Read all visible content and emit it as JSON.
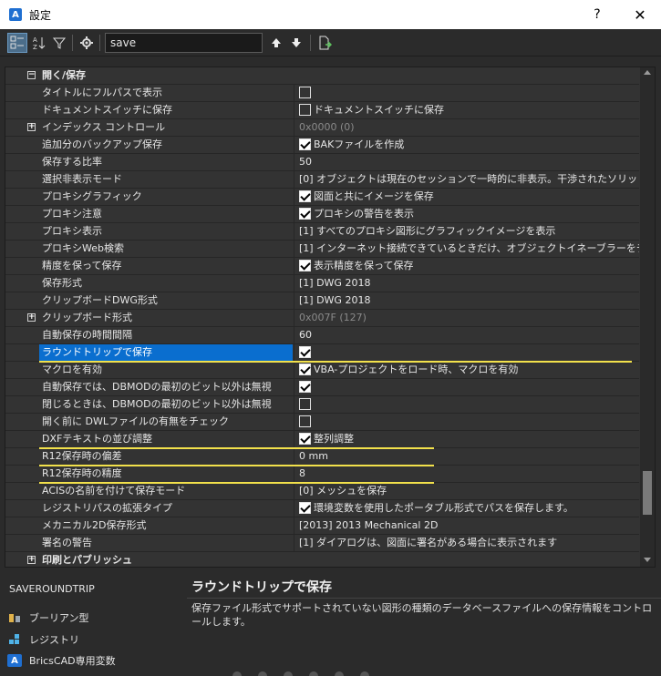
{
  "window": {
    "title": "設定",
    "help_label": "?",
    "close_label": "✕",
    "app_icon": "bricscad-icon"
  },
  "toolbar": {
    "search_value": "save",
    "buttons": [
      "categorized-view-icon",
      "alphabetical-sort-icon",
      "filter-icon",
      "settings-gear-icon",
      "arrow-up-icon",
      "arrow-down-icon",
      "export-icon"
    ]
  },
  "categories": {
    "open_save": "開く/保存",
    "print_publish": "印刷とパブリッシュ"
  },
  "rows": [
    {
      "name": "タイトルにフルパスで表示",
      "value": "",
      "checkbox": "empty"
    },
    {
      "name": "ドキュメントスイッチに保存",
      "value": "ドキュメントスイッチに保存",
      "checkbox": "empty"
    },
    {
      "name": "インデックス コントロール",
      "value": "0x0000 (0)",
      "expander": "+",
      "disabled": true
    },
    {
      "name": "追加分のバックアップ保存",
      "value": "BAKファイルを作成",
      "checkbox": "checked"
    },
    {
      "name": "保存する比率",
      "value": "50"
    },
    {
      "name": "選択非表示モード",
      "value": "[0] オブジェクトは現在のセッションで一時的に非表示。干渉されたソリッドは、干渉"
    },
    {
      "name": "プロキシグラフィック",
      "value": "図面と共にイメージを保存",
      "checkbox": "checked"
    },
    {
      "name": "プロキシ注意",
      "value": "プロキシの警告を表示",
      "checkbox": "checked"
    },
    {
      "name": "プロキシ表示",
      "value": "[1] すべてのプロキシ図形にグラフィックイメージを表示"
    },
    {
      "name": "プロキシWeb検索",
      "value": "[1] インターネット接続できているときだけ、オブジェクトイネーブラーをチェック"
    },
    {
      "name": "精度を保って保存",
      "value": "表示精度を保って保存",
      "checkbox": "checked"
    },
    {
      "name": "保存形式",
      "value": "[1] DWG 2018"
    },
    {
      "name": "クリップボードDWG形式",
      "value": "[1] DWG 2018"
    },
    {
      "name": "クリップボード形式",
      "value": "0x007F (127)",
      "expander": "+",
      "disabled": true
    },
    {
      "name": "自動保存の時間間隔",
      "value": "60"
    },
    {
      "name": "ラウンドトリップで保存",
      "value": "",
      "checkbox": "checked",
      "selected": true
    },
    {
      "name": "マクロを有効",
      "value": "VBA-プロジェクトをロード時、マクロを有効",
      "checkbox": "checked"
    },
    {
      "name": "自動保存では、DBMODの最初のビット以外は無視",
      "value": "",
      "checkbox": "checked"
    },
    {
      "name": "閉じるときは、DBMODの最初のビット以外は無視",
      "value": "",
      "checkbox": "empty"
    },
    {
      "name": "開く前に DWLファイルの有無をチェック",
      "value": "",
      "checkbox": "empty"
    },
    {
      "name": "DXFテキストの並び調整",
      "value": "整列調整",
      "checkbox": "checked"
    },
    {
      "name": "R12保存時の偏差",
      "value": "0 mm"
    },
    {
      "name": "R12保存時の精度",
      "value": "8"
    },
    {
      "name": "ACISの名前を付けて保存モード",
      "value": "[0] メッシュを保存"
    },
    {
      "name": "レジストリパスの拡張タイプ",
      "value": "環境変数を使用したポータブル形式でパスを保存します。",
      "checkbox": "checked"
    },
    {
      "name": "メカニカル2D保存形式",
      "value": "[2013] 2013 Mechanical 2D"
    },
    {
      "name": "署名の警告",
      "value": "[1] ダイアログは、図面に署名がある場合に表示されます"
    }
  ],
  "info": {
    "variable_name": "SAVEROUNDTRIP",
    "title": "ラウンドトリップで保存",
    "description": "保存ファイル形式でサポートされていない図形の種類のデータベースファイルへの保存情報をコントロールします。"
  },
  "legend": [
    {
      "label": "ブーリアン型",
      "icon": "boolean-icon"
    },
    {
      "label": "レジストリ",
      "icon": "registry-icon"
    },
    {
      "label": "BricsCAD専用変数",
      "icon": "bricscad-variable-icon"
    }
  ],
  "colors": {
    "highlight_line": "#f2e14b",
    "selection": "#0a6ecf"
  }
}
